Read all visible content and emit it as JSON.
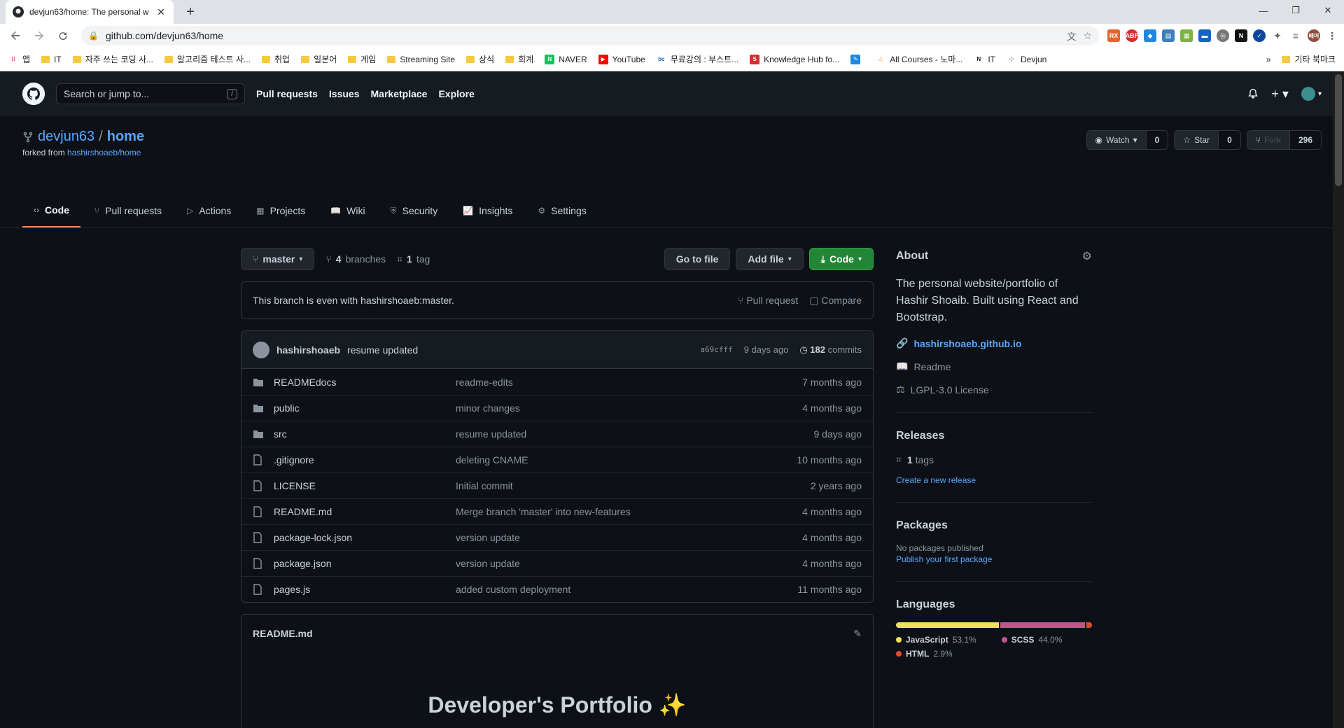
{
  "browser": {
    "tab_title": "devjun63/home: The personal w",
    "url": "github.com/devjun63/home",
    "bookmarks": [
      {
        "label": "앱",
        "icon": "apps-icon"
      },
      {
        "label": "IT",
        "icon": "folder-icon"
      },
      {
        "label": "자주 쓰는 코딩 사...",
        "icon": "folder-icon"
      },
      {
        "label": "알고리즘 테스트 사...",
        "icon": "folder-icon"
      },
      {
        "label": "취업",
        "icon": "folder-icon"
      },
      {
        "label": "일본어",
        "icon": "folder-icon"
      },
      {
        "label": "게임",
        "icon": "folder-icon"
      },
      {
        "label": "Streaming Site",
        "icon": "folder-icon"
      },
      {
        "label": "상식",
        "icon": "folder-icon"
      },
      {
        "label": "회계",
        "icon": "folder-icon"
      },
      {
        "label": "NAVER",
        "icon": "naver-icon"
      },
      {
        "label": "YouTube",
        "icon": "youtube-icon"
      },
      {
        "label": "무료강의 : 부스트...",
        "icon": "bc-icon"
      },
      {
        "label": "Knowledge Hub fo...",
        "icon": "s-icon"
      },
      {
        "label": "",
        "icon": "pen-icon"
      },
      {
        "label": "All Courses - 노마...",
        "icon": "warning-icon"
      },
      {
        "label": "IT",
        "icon": "notion-icon"
      },
      {
        "label": "Devjun",
        "icon": "dots-icon"
      }
    ],
    "bookmarks_more": "»",
    "other_bookmarks": "기타 북마크",
    "profile_text": "배어"
  },
  "gh": {
    "search_placeholder": "Search or jump to...",
    "search_key": "/",
    "nav": [
      "Pull requests",
      "Issues",
      "Marketplace",
      "Explore"
    ]
  },
  "repo": {
    "owner": "devjun63",
    "separator": "/",
    "name": "home",
    "forked_from_prefix": "forked from",
    "forked_from": "hashirshoaeb/home",
    "watch_label": "Watch",
    "watch_count": "0",
    "star_label": "Star",
    "star_count": "0",
    "fork_label": "Fork",
    "fork_count": "296",
    "tabs": [
      {
        "label": "Code",
        "icon": "code-icon",
        "active": true
      },
      {
        "label": "Pull requests",
        "icon": "pull-request-icon"
      },
      {
        "label": "Actions",
        "icon": "play-icon"
      },
      {
        "label": "Projects",
        "icon": "project-icon"
      },
      {
        "label": "Wiki",
        "icon": "book-icon"
      },
      {
        "label": "Security",
        "icon": "shield-icon"
      },
      {
        "label": "Insights",
        "icon": "graph-icon"
      },
      {
        "label": "Settings",
        "icon": "gear-icon"
      }
    ]
  },
  "code": {
    "branch": "master",
    "branches_count": "4",
    "branches_label": "branches",
    "tags_count": "1",
    "tags_label": "tag",
    "go_to_file": "Go to file",
    "add_file": "Add file",
    "code_button": "Code",
    "even_text": "This branch is even with hashirshoaeb:master.",
    "pull_request": "Pull request",
    "compare": "Compare",
    "commit_author": "hashirshoaeb",
    "commit_message": "resume updated",
    "commit_sha": "a69cfff",
    "commit_age": "9 days ago",
    "commits_count": "182",
    "commits_label": "commits",
    "files": [
      {
        "type": "dir",
        "name": "READMEdocs",
        "msg": "readme-edits",
        "age": "7 months ago"
      },
      {
        "type": "dir",
        "name": "public",
        "msg": "minor changes",
        "age": "4 months ago"
      },
      {
        "type": "dir",
        "name": "src",
        "msg": "resume updated",
        "age": "9 days ago"
      },
      {
        "type": "file",
        "name": ".gitignore",
        "msg": "deleting CNAME",
        "age": "10 months ago"
      },
      {
        "type": "file",
        "name": "LICENSE",
        "msg": "Initial commit",
        "age": "2 years ago"
      },
      {
        "type": "file",
        "name": "README.md",
        "msg": "Merge branch 'master' into new-features",
        "age": "4 months ago"
      },
      {
        "type": "file",
        "name": "package-lock.json",
        "msg": "version update",
        "age": "4 months ago"
      },
      {
        "type": "file",
        "name": "package.json",
        "msg": "version update",
        "age": "4 months ago"
      },
      {
        "type": "file",
        "name": "pages.js",
        "msg": "added custom deployment",
        "age": "11 months ago"
      }
    ],
    "readme_file": "README.md",
    "readme_title": "Developer's Portfolio ✨"
  },
  "about": {
    "title": "About",
    "description": "The personal website/portfolio of Hashir Shoaib. Built using React and Bootstrap.",
    "link": "hashirshoaeb.github.io",
    "readme": "Readme",
    "license": "LGPL-3.0 License",
    "releases_title": "Releases",
    "releases_count": "1",
    "releases_label": "tags",
    "create_release": "Create a new release",
    "packages_title": "Packages",
    "no_packages": "No packages published",
    "publish_package": "Publish your first package",
    "languages_title": "Languages",
    "languages": [
      {
        "name": "JavaScript",
        "pct": "53.1%",
        "value": 53.1,
        "color": "#f1e05a"
      },
      {
        "name": "SCSS",
        "pct": "44.0%",
        "value": 44.0,
        "color": "#c6538c"
      },
      {
        "name": "HTML",
        "pct": "2.9%",
        "value": 2.9,
        "color": "#e34c26"
      }
    ]
  }
}
